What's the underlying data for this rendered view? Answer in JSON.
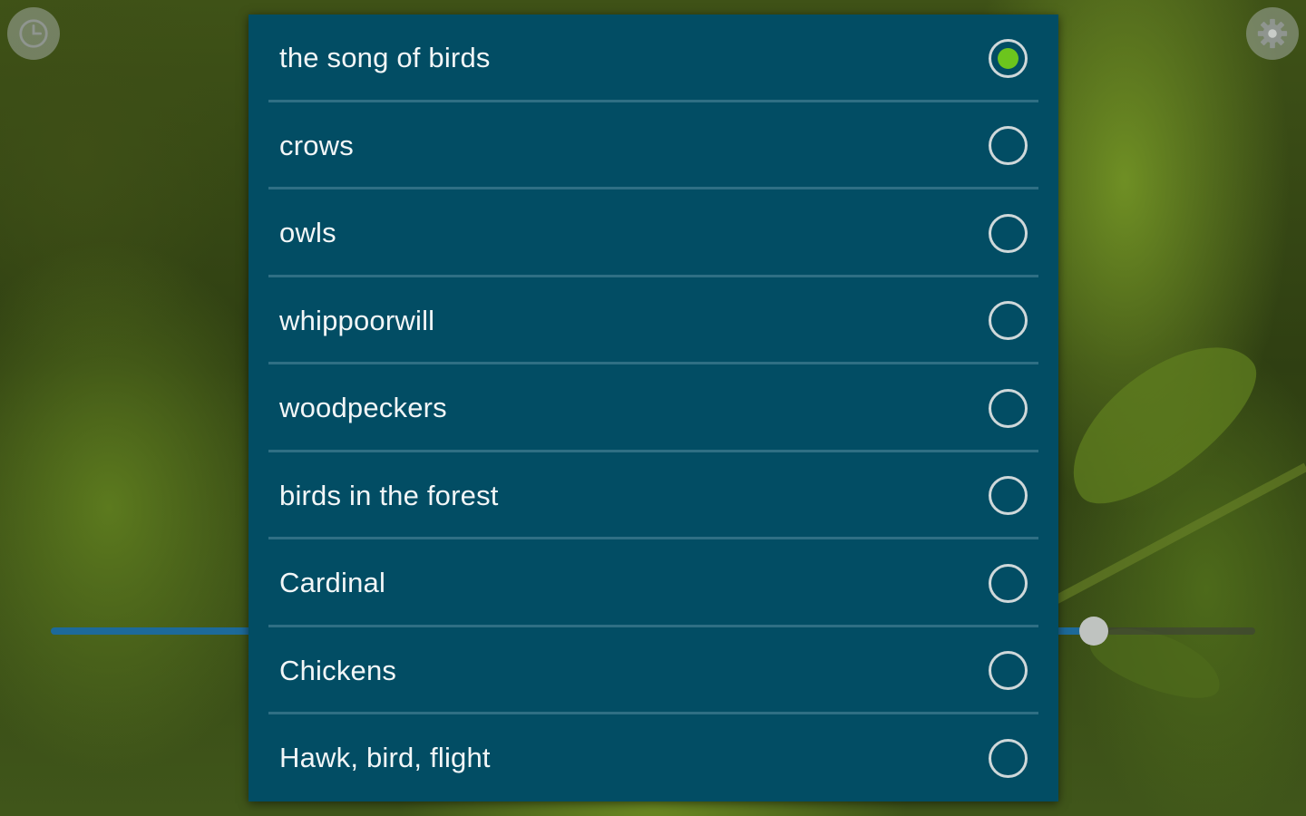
{
  "background": {
    "description_icons": [
      "clock-icon",
      "gear-icon"
    ],
    "accent_color": "#6cc51d",
    "dialog_color": "#024d64"
  },
  "seekbar": {
    "progress": 0.87
  },
  "sound_list": {
    "selected_index": 0,
    "options": [
      {
        "label": "the song of birds",
        "selected": true
      },
      {
        "label": "crows",
        "selected": false
      },
      {
        "label": "owls",
        "selected": false
      },
      {
        "label": "whippoorwill",
        "selected": false
      },
      {
        "label": "woodpeckers",
        "selected": false
      },
      {
        "label": "birds in the forest",
        "selected": false
      },
      {
        "label": "Cardinal",
        "selected": false
      },
      {
        "label": "Chickens",
        "selected": false
      },
      {
        "label": "Hawk, bird, flight",
        "selected": false
      }
    ]
  }
}
